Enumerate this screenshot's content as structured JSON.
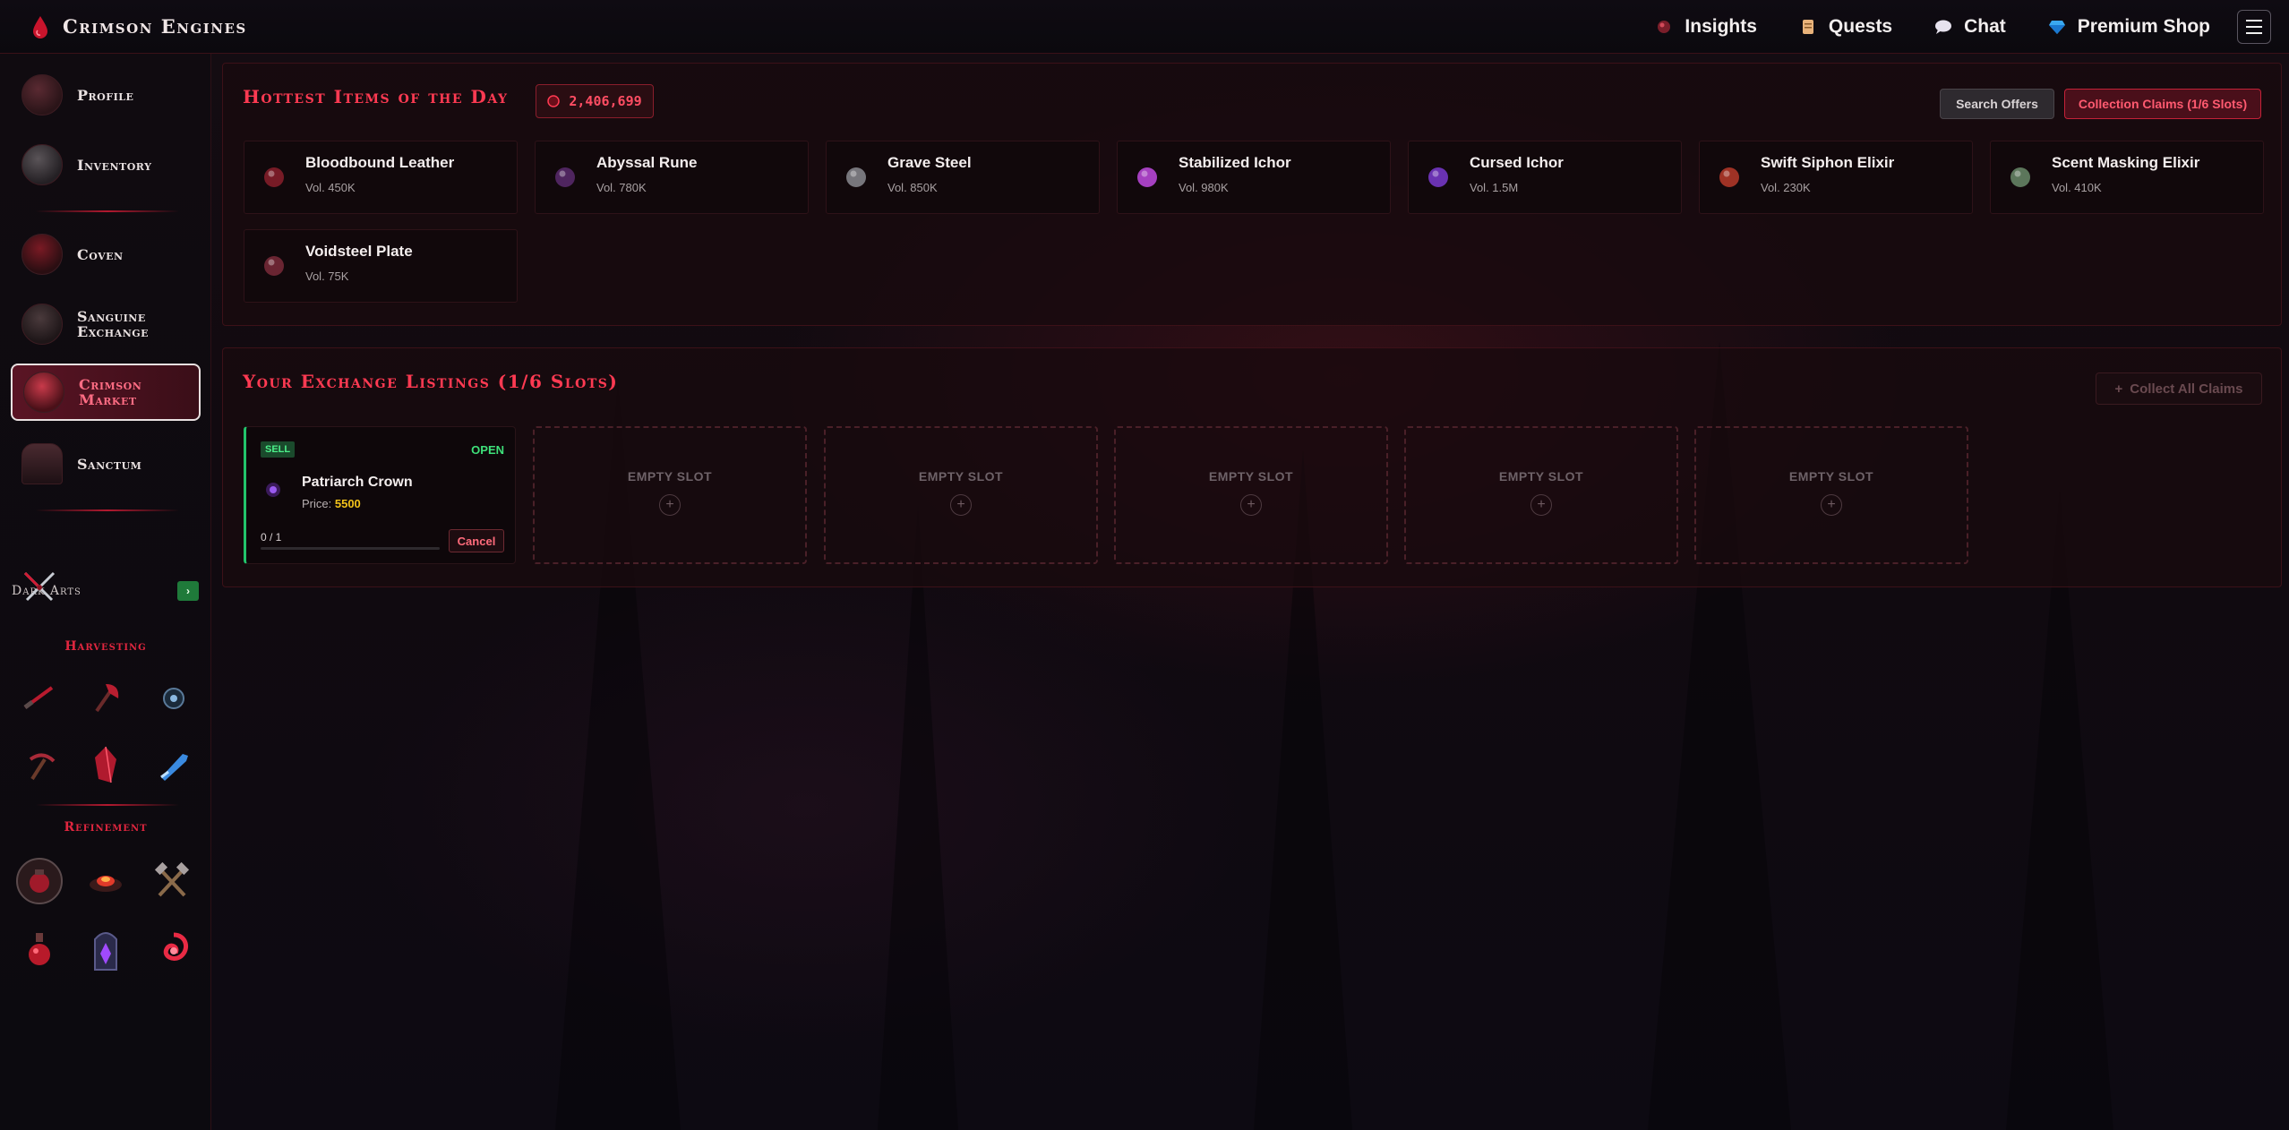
{
  "app": {
    "title": "Crimson Engines"
  },
  "topnav": [
    {
      "label": "Insights",
      "icon": "orb-icon"
    },
    {
      "label": "Quests",
      "icon": "scroll-icon"
    },
    {
      "label": "Chat",
      "icon": "speech-bubble-icon"
    },
    {
      "label": "Premium Shop",
      "icon": "diamond-icon"
    }
  ],
  "sidebar": {
    "items": [
      {
        "label": "Profile",
        "icon": "profile-emblem-icon"
      },
      {
        "label": "Inventory",
        "icon": "inventory-emblem-icon"
      },
      {
        "label": "Coven",
        "icon": "coven-shield-icon"
      },
      {
        "label": "Sanguine Exchange",
        "icon": "scales-icon"
      },
      {
        "label": "Crimson Market",
        "icon": "market-cart-icon",
        "active": true
      },
      {
        "label": "Sanctum",
        "icon": "sanctum-door-icon"
      }
    ],
    "dark_arts_label": "Dark Arts",
    "dark_arts_toggle": "›",
    "harvesting_label": "Harvesting",
    "refinement_label": "Refinement",
    "dark_arts_skills": [
      "crossed-daggers-icon"
    ],
    "harvesting_skills": [
      "dagger-icon",
      "axe-icon",
      "orb-net-icon",
      "pickaxe-icon",
      "crystal-shard-icon",
      "ice-blade-icon"
    ],
    "refinement_skills": [
      "cauldron-icon",
      "forge-icon",
      "crossed-hammers-icon",
      "potion-flask-icon",
      "rune-tablet-icon",
      "blood-vortex-icon"
    ]
  },
  "hot_items": {
    "title": "Hottest Items of the Day",
    "gold_amount": "2,406,699",
    "search_offers_label": "Search Offers",
    "collection_claims_label": "Collection Claims (1/6 Slots)",
    "items": [
      {
        "name": "Bloodbound Leather",
        "volume": "Vol. 450K",
        "icon": "leather-icon",
        "color": "#8a1e2c"
      },
      {
        "name": "Abyssal Rune",
        "volume": "Vol. 780K",
        "icon": "rune-orb-icon",
        "color": "#5a2a6e"
      },
      {
        "name": "Grave Steel",
        "volume": "Vol. 850K",
        "icon": "steel-shard-icon",
        "color": "#8a8a90"
      },
      {
        "name": "Stabilized Ichor",
        "volume": "Vol. 980K",
        "icon": "violet-crystal-icon",
        "color": "#c04ae0"
      },
      {
        "name": "Cursed Ichor",
        "volume": "Vol. 1.5M",
        "icon": "purple-crystal-icon",
        "color": "#7a3ad0"
      },
      {
        "name": "Swift Siphon Elixir",
        "volume": "Vol. 230K",
        "icon": "red-elixir-icon",
        "color": "#b83a2a"
      },
      {
        "name": "Scent Masking Elixir",
        "volume": "Vol. 410K",
        "icon": "green-elixir-icon",
        "color": "#6a8a6a"
      },
      {
        "name": "Voidsteel Plate",
        "volume": "Vol. 75K",
        "icon": "plate-icon",
        "color": "#7a2a3a"
      }
    ]
  },
  "listings": {
    "title": "Your Exchange Listings (1/6 Slots)",
    "collect_all_label": "Collect All Claims",
    "active": {
      "type": "SELL",
      "status": "OPEN",
      "name": "Patriarch Crown",
      "price_label": "Price:",
      "price": "5500",
      "quantity": "0 / 1",
      "progress": 0,
      "cancel_label": "Cancel"
    },
    "empty_slot_label": "EMPTY SLOT",
    "empty_slot_plus": "+",
    "empty_count": 5
  },
  "colors": {
    "accent": "#ff3a52",
    "open_green": "#22c46b",
    "gold": "#f2c21a"
  }
}
